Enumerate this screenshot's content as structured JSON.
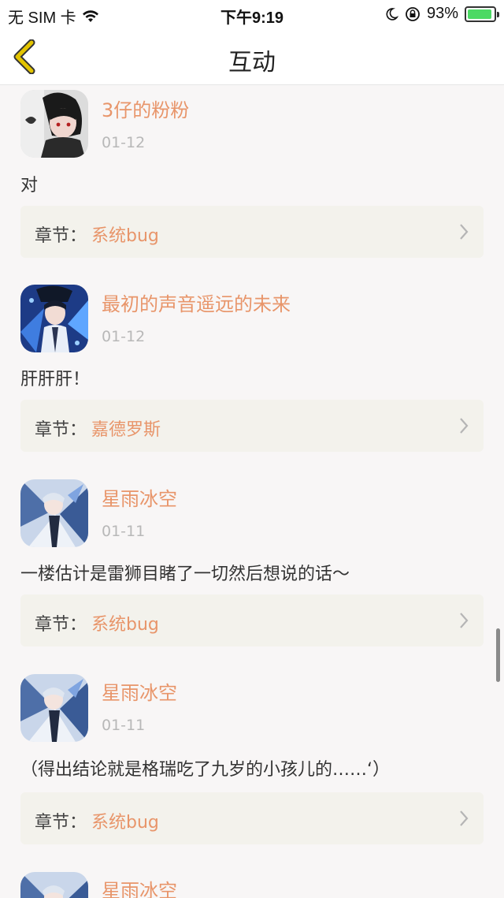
{
  "status_bar": {
    "carrier": "无 SIM 卡",
    "time": "下午9:19",
    "battery_percent": "93%",
    "battery_level": 0.93
  },
  "nav": {
    "title": "互动",
    "back_icon": "chevron-left-icon",
    "accent": "#e3c400"
  },
  "colors": {
    "username": "#e8956a",
    "chapter_name": "#e8956a",
    "date": "#b8b8b8",
    "card_bg": "#f3f2ec"
  },
  "posts": [
    {
      "username": "3仔的粉粉",
      "date": "01-12",
      "comment": "对",
      "chapter_label": "章节：",
      "chapter_name": "系统bug"
    },
    {
      "username": "最初的声音遥远的未来",
      "date": "01-12",
      "comment": "肝肝肝！",
      "chapter_label": "章节：",
      "chapter_name": "嘉德罗斯"
    },
    {
      "username": "星雨冰空",
      "date": "01-11",
      "comment": "一楼估计是雷狮目睹了一切然后想说的话～",
      "chapter_label": "章节：",
      "chapter_name": "系统bug"
    },
    {
      "username": "星雨冰空",
      "date": "01-11",
      "comment": "（得出结论就是格瑞吃了九岁的小孩儿的……‘）",
      "chapter_label": "章节：",
      "chapter_name": "系统bug"
    },
    {
      "username": "星雨冰空"
    }
  ]
}
